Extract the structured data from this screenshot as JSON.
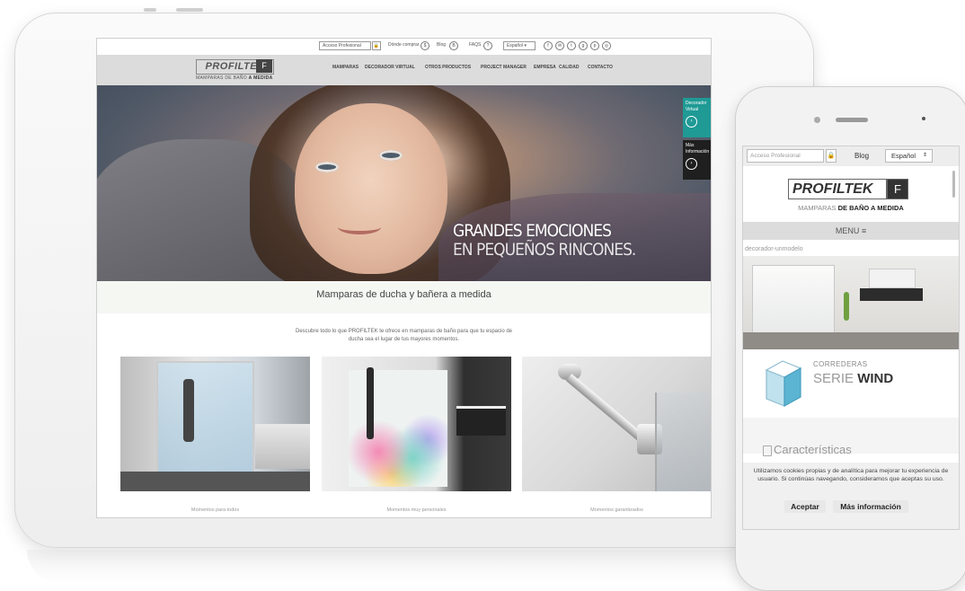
{
  "tablet": {
    "topbar": {
      "acceso": "Acceso Profesional",
      "donde": "Dónde comprar",
      "blog": "Blog",
      "faqs": "FAQS",
      "lang": "Español"
    },
    "logo": {
      "name": "PROFILTEK",
      "mark": "F",
      "sub_a": "MAMPARAS DE BAÑO",
      "sub_b": "A MEDIDA"
    },
    "nav": [
      "MAMPARAS",
      "DECORADOR VIRTUAL",
      "OTROS PRODUCTOS",
      "PROJECT MANAGER",
      "EMPRESA",
      "CALIDAD",
      "CONTACTO"
    ],
    "hero": {
      "line1": "GRANDES EMOCIONES",
      "line2": "EN PEQUEÑOS RINCONES.",
      "side1": {
        "l1": "Decorador",
        "l2": "Virtual"
      },
      "side2": {
        "l1": "Más",
        "l2": "Información"
      }
    },
    "tagline": "Mamparas de ducha y bañera a medida",
    "intro": "Descubre todo lo que PROFILTEK te ofrece en mamparas de baño para que tu espacio de ducha sea el lugar de tus mayores momentos.",
    "captions": [
      "Momentos para todos",
      "Momentos muy personales",
      "Momentos garantizados"
    ]
  },
  "phone": {
    "acceso_placeholder": "Acceso Profesional",
    "blog": "Blog",
    "lang": "Español",
    "logo": {
      "name": "PROFILTEK",
      "mark": "F",
      "sub_a": "MAMPARAS",
      "sub_b": "DE BAÑO A MEDIDA"
    },
    "menu": "MENU ≡",
    "category_label": "decorador-unmodelo",
    "product": {
      "label": "CORREDERAS",
      "serie": "SERIE",
      "name": "WIND"
    },
    "feature": "Características",
    "cookie_text": "Utilizamos cookies propias y de analítica para mejorar tu experiencia de usuario. Si continúas navegando, consideramos que aceptas su uso.",
    "accept": "Aceptar",
    "more_info": "Más información"
  },
  "colors": {
    "teal": "#1f9a95",
    "dark": "#1f1f1f",
    "gray_bar": "#dcdcdc"
  }
}
